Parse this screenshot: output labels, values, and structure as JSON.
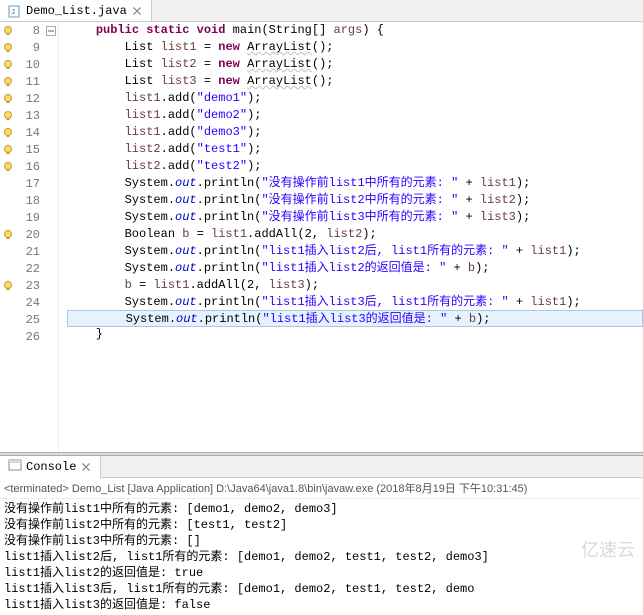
{
  "tab": {
    "label": "Demo_List.java",
    "icon": "java-file-icon"
  },
  "code_lines": [
    {
      "num": 8,
      "marker": "lightbulb",
      "fold": "minus",
      "html": "    <span class='kw'>public</span> <span class='kw'>static</span> <span class='kw'>void</span> main(String[] <span class='param'>args</span>) {"
    },
    {
      "num": 9,
      "marker": "lightbulb",
      "fold": "",
      "html": "        List <span class='var'>list1</span> = <span class='kw'>new</span> <span class='soft'>ArrayList</span>();"
    },
    {
      "num": 10,
      "marker": "lightbulb",
      "fold": "",
      "html": "        List <span class='var'>list2</span> = <span class='kw'>new</span> <span class='soft'>ArrayList</span>();"
    },
    {
      "num": 11,
      "marker": "lightbulb",
      "fold": "",
      "html": "        List <span class='var'>list3</span> = <span class='kw'>new</span> <span class='soft'>ArrayList</span>();"
    },
    {
      "num": 12,
      "marker": "lightbulb",
      "fold": "",
      "html": "        <span class='var'>list1</span>.add(<span class='str'>\"demo1\"</span>);"
    },
    {
      "num": 13,
      "marker": "lightbulb",
      "fold": "",
      "html": "        <span class='var'>list1</span>.add(<span class='str'>\"demo2\"</span>);"
    },
    {
      "num": 14,
      "marker": "lightbulb",
      "fold": "",
      "html": "        <span class='var'>list1</span>.add(<span class='str'>\"demo3\"</span>);"
    },
    {
      "num": 15,
      "marker": "lightbulb",
      "fold": "",
      "html": "        <span class='var'>list2</span>.add(<span class='str'>\"test1\"</span>);"
    },
    {
      "num": 16,
      "marker": "lightbulb",
      "fold": "",
      "html": "        <span class='var'>list2</span>.add(<span class='str'>\"test2\"</span>);"
    },
    {
      "num": 17,
      "marker": "",
      "fold": "",
      "html": "        System.<span class='static-f'>out</span>.println(<span class='str'>\"没有操作前list1中所有的元素: \"</span> + <span class='var'>list1</span>);"
    },
    {
      "num": 18,
      "marker": "",
      "fold": "",
      "html": "        System.<span class='static-f'>out</span>.println(<span class='str'>\"没有操作前list2中所有的元素: \"</span> + <span class='var'>list2</span>);"
    },
    {
      "num": 19,
      "marker": "",
      "fold": "",
      "html": "        System.<span class='static-f'>out</span>.println(<span class='str'>\"没有操作前list3中所有的元素: \"</span> + <span class='var'>list3</span>);"
    },
    {
      "num": 20,
      "marker": "lightbulb",
      "fold": "",
      "html": "        Boolean <span class='var'>b</span> = <span class='var'>list1</span>.addAll(2, <span class='var'>list2</span>);"
    },
    {
      "num": 21,
      "marker": "",
      "fold": "",
      "html": "        System.<span class='static-f'>out</span>.println(<span class='str'>\"list1插入list2后, list1所有的元素: \"</span> + <span class='var'>list1</span>);"
    },
    {
      "num": 22,
      "marker": "",
      "fold": "",
      "html": "        System.<span class='static-f'>out</span>.println(<span class='str'>\"list1插入list2的返回值是: \"</span> + <span class='var'>b</span>);"
    },
    {
      "num": 23,
      "marker": "lightbulb",
      "fold": "",
      "html": "        <span class='var'>b</span> = <span class='var'>list1</span>.addAll(2, <span class='var'>list3</span>);"
    },
    {
      "num": 24,
      "marker": "",
      "fold": "",
      "html": "        System.<span class='static-f'>out</span>.println(<span class='str'>\"list1插入list3后, list1所有的元素: \"</span> + <span class='var'>list1</span>);"
    },
    {
      "num": 25,
      "marker": "",
      "fold": "",
      "hl": true,
      "html": "        System.<span class='static-f'>out</span>.println(<span class='str'>\"list1插入list3的返回值是: \"</span> + <span class='var'>b</span>);"
    },
    {
      "num": 26,
      "marker": "",
      "fold": "",
      "html": "    }"
    }
  ],
  "console": {
    "tab_label": "Console",
    "header": "<terminated> Demo_List [Java Application] D:\\Java64\\java1.8\\bin\\javaw.exe (2018年8月19日 下午10:31:45)",
    "lines": [
      "没有操作前list1中所有的元素: [demo1, demo2, demo3]",
      "没有操作前list2中所有的元素: [test1, test2]",
      "没有操作前list3中所有的元素: []",
      "list1插入list2后, list1所有的元素: [demo1, demo2, test1, test2, demo3]",
      "list1插入list2的返回值是: true",
      "list1插入list3后, list1所有的元素: [demo1, demo2, test1, test2, demo",
      "list1插入list3的返回值是: false"
    ]
  },
  "watermark": "亿速云"
}
